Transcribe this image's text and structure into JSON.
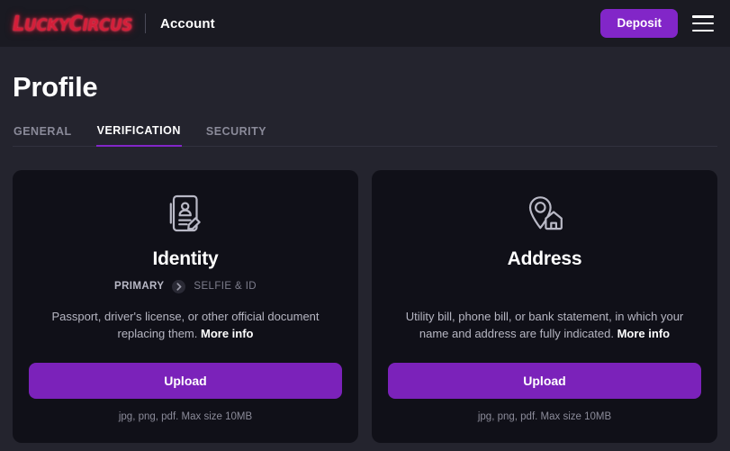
{
  "header": {
    "logo_text_1": "L",
    "logo_text_2": "UCKY",
    "logo_text_3": "C",
    "logo_text_4": "IRCUS",
    "logo_full": "LUCKYCIRCUS",
    "title": "Account",
    "deposit_label": "Deposit",
    "menu_icon": "hamburger-menu-icon"
  },
  "page": {
    "title": "Profile",
    "tabs": [
      {
        "label": "GENERAL",
        "active": false
      },
      {
        "label": "VERIFICATION",
        "active": true
      },
      {
        "label": "SECURITY",
        "active": false
      }
    ]
  },
  "cards": [
    {
      "icon": "id-document-person-pencil-icon",
      "title": "Identity",
      "badge_primary": "PRIMARY",
      "badge_arrow_icon": "chevron-right-circle-icon",
      "badge_secondary": "SELFIE & ID",
      "description": "Passport, driver's license, or other official document replacing them.",
      "more_info": "More info",
      "upload_label": "Upload",
      "upload_hint": "jpg, png, pdf. Max size 10MB"
    },
    {
      "icon": "location-pin-house-icon",
      "title": "Address",
      "description": "Utility bill, phone bill, or bank statement, in which your name and address are fully indicated.",
      "more_info": "More info",
      "upload_label": "Upload",
      "upload_hint": "jpg, png, pdf. Max size 10MB"
    }
  ],
  "colors": {
    "accent_purple": "#7b22ba",
    "deposit_purple": "#8226c8",
    "page_bg": "#24242e",
    "header_bg": "#1a1a22",
    "card_bg": "#101018",
    "logo_red": "#d41f3a"
  }
}
